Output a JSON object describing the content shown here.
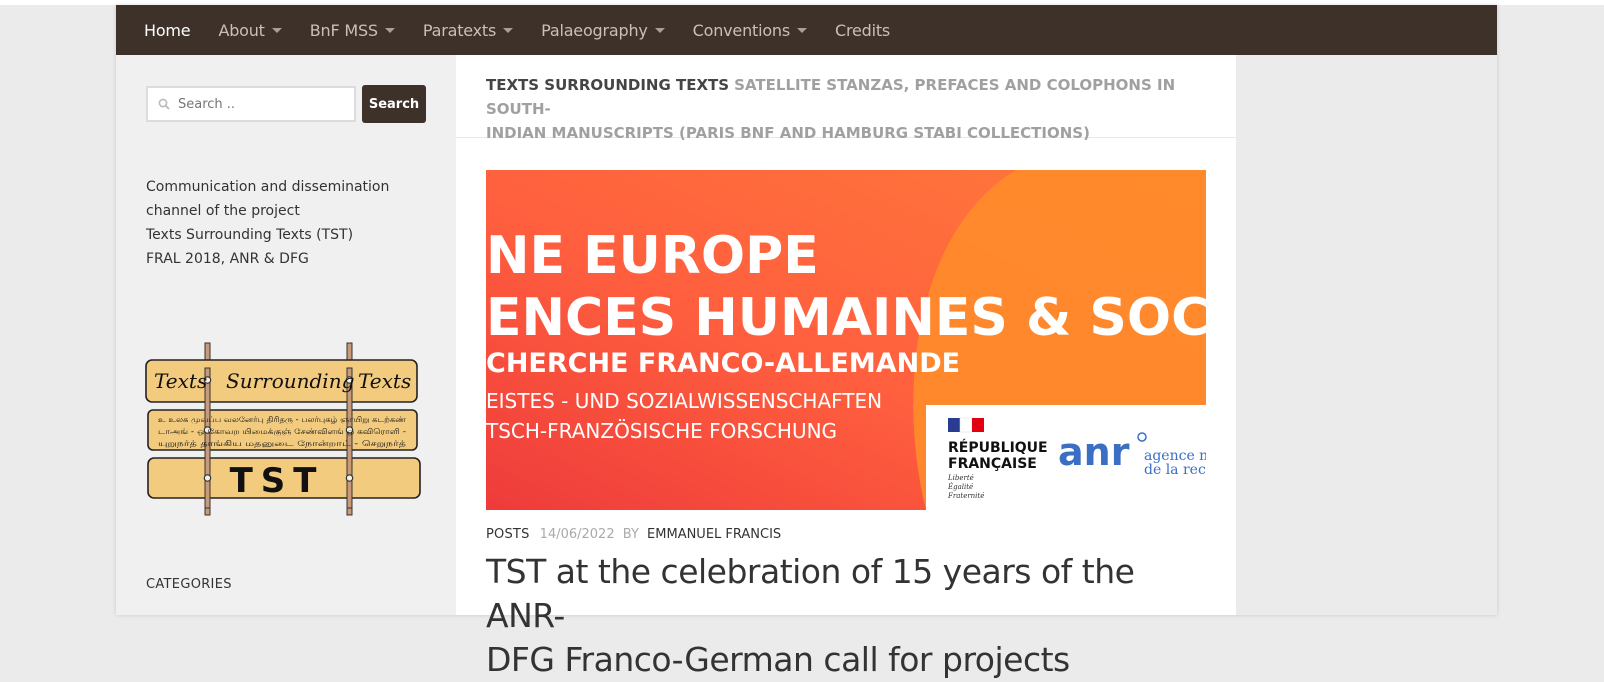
{
  "nav": {
    "items": [
      {
        "label": "Home",
        "active": true,
        "dropdown": false
      },
      {
        "label": "About",
        "active": false,
        "dropdown": true
      },
      {
        "label": "BnF MSS",
        "active": false,
        "dropdown": true
      },
      {
        "label": "Paratexts",
        "active": false,
        "dropdown": true
      },
      {
        "label": "Palaeography",
        "active": false,
        "dropdown": true
      },
      {
        "label": "Conventions",
        "active": false,
        "dropdown": true
      },
      {
        "label": "Credits",
        "active": false,
        "dropdown": false
      }
    ]
  },
  "search": {
    "placeholder": "Search ..",
    "button_label": "Search"
  },
  "sidebar": {
    "description_lines": [
      "Communication and dissemination",
      "channel of the project",
      "Texts Surrounding Texts (TST)",
      "FRAL 2018, ANR & DFG"
    ],
    "logo": {
      "top_text": [
        "Texts",
        "Surrounding",
        "Texts"
      ],
      "middle_lines": [
        "உ உலக முவப்ப வலனேர்பு திரிதரு - பலர்புகழ் ஞாயிறு கடற்கண்",
        "டாஅங் - ஒ கோவற யிமைக்குஞ் சேண்விளங் ஒ கவிரொளி -",
        "யுறுநர்த் தாங்கிய மதனுடை நோன்றாட் - செறுநர்த்"
      ],
      "bottom_text": "TST"
    },
    "categories_title": "CATEGORIES"
  },
  "header": {
    "title_strong": "TEXTS SURROUNDING TEXTS",
    "title_light_1": "SATELLITE STANZAS, PREFACES AND COLOPHONS IN SOUTH-",
    "title_light_2": "INDIAN MANUSCRIPTS (PARIS BNF AND HAMBURG STABI COLLECTIONS)"
  },
  "banner": {
    "line1": "NE EUROPE",
    "line2": "ENCES HUMAINES & SOC",
    "line3": "CHERCHE FRANCO-ALLEMANDE",
    "line4": "EISTES - UND SOZIALWISSENSCHAFTEN",
    "line5": "TSCH-FRANZÖSISCHE FORSCHUNG",
    "rf_1": "RÉPUBLIQUE",
    "rf_2": "FRANÇAISE",
    "rf_motto_1": "Liberté",
    "rf_motto_2": "Égalité",
    "rf_motto_3": "Fraternité",
    "anr": "anr",
    "anr_sub_1": "agence nati",
    "anr_sub_2": "de la recher",
    "colors": {
      "orange": "#ff6a3d",
      "red": "#ee3b3b",
      "light_orange": "#ff8c2a",
      "anr_blue": "#3a6fc4"
    }
  },
  "post": {
    "category": "POSTS",
    "date": "14/06/2022",
    "by": "BY",
    "author": "EMMANUEL FRANCIS",
    "title": "TST at the celebration of 15 years of the ANR-",
    "title_line2": "DFG Franco-German call for projects"
  },
  "colors": {
    "nav_bg": "#3d3129",
    "sidebar_bg": "#f0f0f0",
    "page_bg": "#ebebeb"
  }
}
